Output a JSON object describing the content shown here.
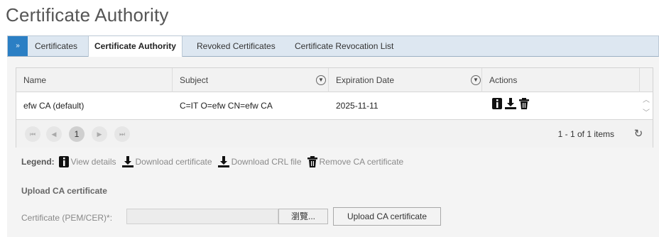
{
  "page": {
    "title": "Certificate Authority"
  },
  "tabs": {
    "toggle": "»",
    "items": [
      {
        "label": "Certificates"
      },
      {
        "label": "Certificate Authority",
        "active": true
      },
      {
        "label": "Revoked Certificates"
      },
      {
        "label": "Certificate Revocation List"
      }
    ]
  },
  "grid": {
    "columns": [
      "Name",
      "Subject",
      "Expiration Date",
      "Actions"
    ],
    "rows": [
      {
        "name": "efw CA (default)",
        "subject": "C=IT O=efw CN=efw CA",
        "expiration": "2025-11-11",
        "actions": [
          "info-icon",
          "download-icon",
          "trash-icon"
        ]
      }
    ],
    "pager": {
      "first": "⏮",
      "prev": "◀",
      "current_page": "1",
      "next": "▶",
      "last": "⏭",
      "info": "1 - 1 of 1 items"
    }
  },
  "legend": {
    "title": "Legend:",
    "items": [
      {
        "icon": "info-icon",
        "label": "View details"
      },
      {
        "icon": "download-icon",
        "label": "Download certificate"
      },
      {
        "icon": "download-icon",
        "label": "Download CRL file"
      },
      {
        "icon": "trash-icon",
        "label": "Remove CA certificate"
      }
    ]
  },
  "upload": {
    "title": "Upload CA certificate",
    "field_label": "Certificate (PEM/CER)*:",
    "browse_label": "瀏覽...",
    "button_label": "Upload CA certificate"
  },
  "colors": {
    "accent": "#2b7fc4",
    "tabbar": "#dde7f1"
  }
}
